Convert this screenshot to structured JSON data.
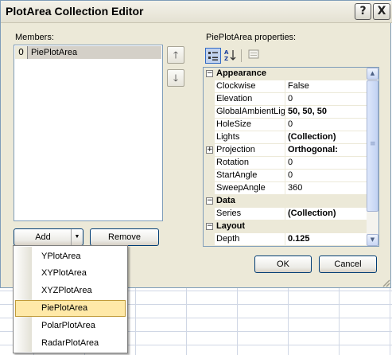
{
  "dialog": {
    "title": "PlotArea Collection Editor",
    "help_glyph": "?",
    "close_glyph": "X"
  },
  "members": {
    "label": "Members:",
    "items": [
      {
        "index": "0",
        "label": "PiePlotArea"
      }
    ],
    "move_up_glyph": "🡑",
    "move_down_glyph": "🡓"
  },
  "buttons": {
    "add": "Add",
    "add_arrow": "▼",
    "remove": "Remove",
    "ok": "OK",
    "cancel": "Cancel"
  },
  "properties": {
    "label": "PiePlotArea properties:",
    "categories": [
      {
        "name": "Appearance",
        "expander": "−"
      },
      {
        "name": "Data",
        "expander": "−"
      },
      {
        "name": "Layout",
        "expander": "−"
      }
    ],
    "rows": [
      {
        "name": "Clockwise",
        "value": "False"
      },
      {
        "name": "Elevation",
        "value": "0"
      },
      {
        "name": "GlobalAmbientLight",
        "value": "50, 50, 50"
      },
      {
        "name": "HoleSize",
        "value": "0"
      },
      {
        "name": "Lights",
        "value": "(Collection)"
      },
      {
        "name": "Projection",
        "value": "Orthogonal:"
      },
      {
        "name": "Rotation",
        "value": "0"
      },
      {
        "name": "StartAngle",
        "value": "0"
      },
      {
        "name": "SweepAngle",
        "value": "360"
      },
      {
        "name": "Series",
        "value": "(Collection)"
      },
      {
        "name": "Depth",
        "value": "0.125"
      }
    ],
    "projection_expander": "+",
    "scroll_up_glyph": "▲",
    "scroll_down_glyph": "▼",
    "thumb_grip": "≡"
  },
  "add_menu": {
    "items": [
      "YPlotArea",
      "XYPlotArea",
      "XYZPlotArea",
      "PiePlotArea",
      "PolarPlotArea",
      "RadarPlotArea"
    ],
    "highlighted": "PiePlotArea"
  },
  "icons": {
    "categorized": "categorized-icon",
    "alphabetical": "alphabetical-icon",
    "property_pages": "property-pages-icon"
  }
}
